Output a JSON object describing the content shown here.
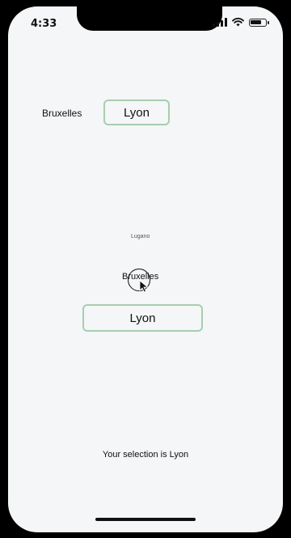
{
  "status_bar": {
    "time": "4:33",
    "battery_level": 0.75
  },
  "top_row": {
    "city_label": "Bruxelles",
    "button_label": "Lyon"
  },
  "picker": {
    "items": [
      "Lugano",
      "Bruxelles"
    ],
    "selected_button_label": "Lyon"
  },
  "footer": {
    "selection_text": "Your selection is Lyon"
  }
}
